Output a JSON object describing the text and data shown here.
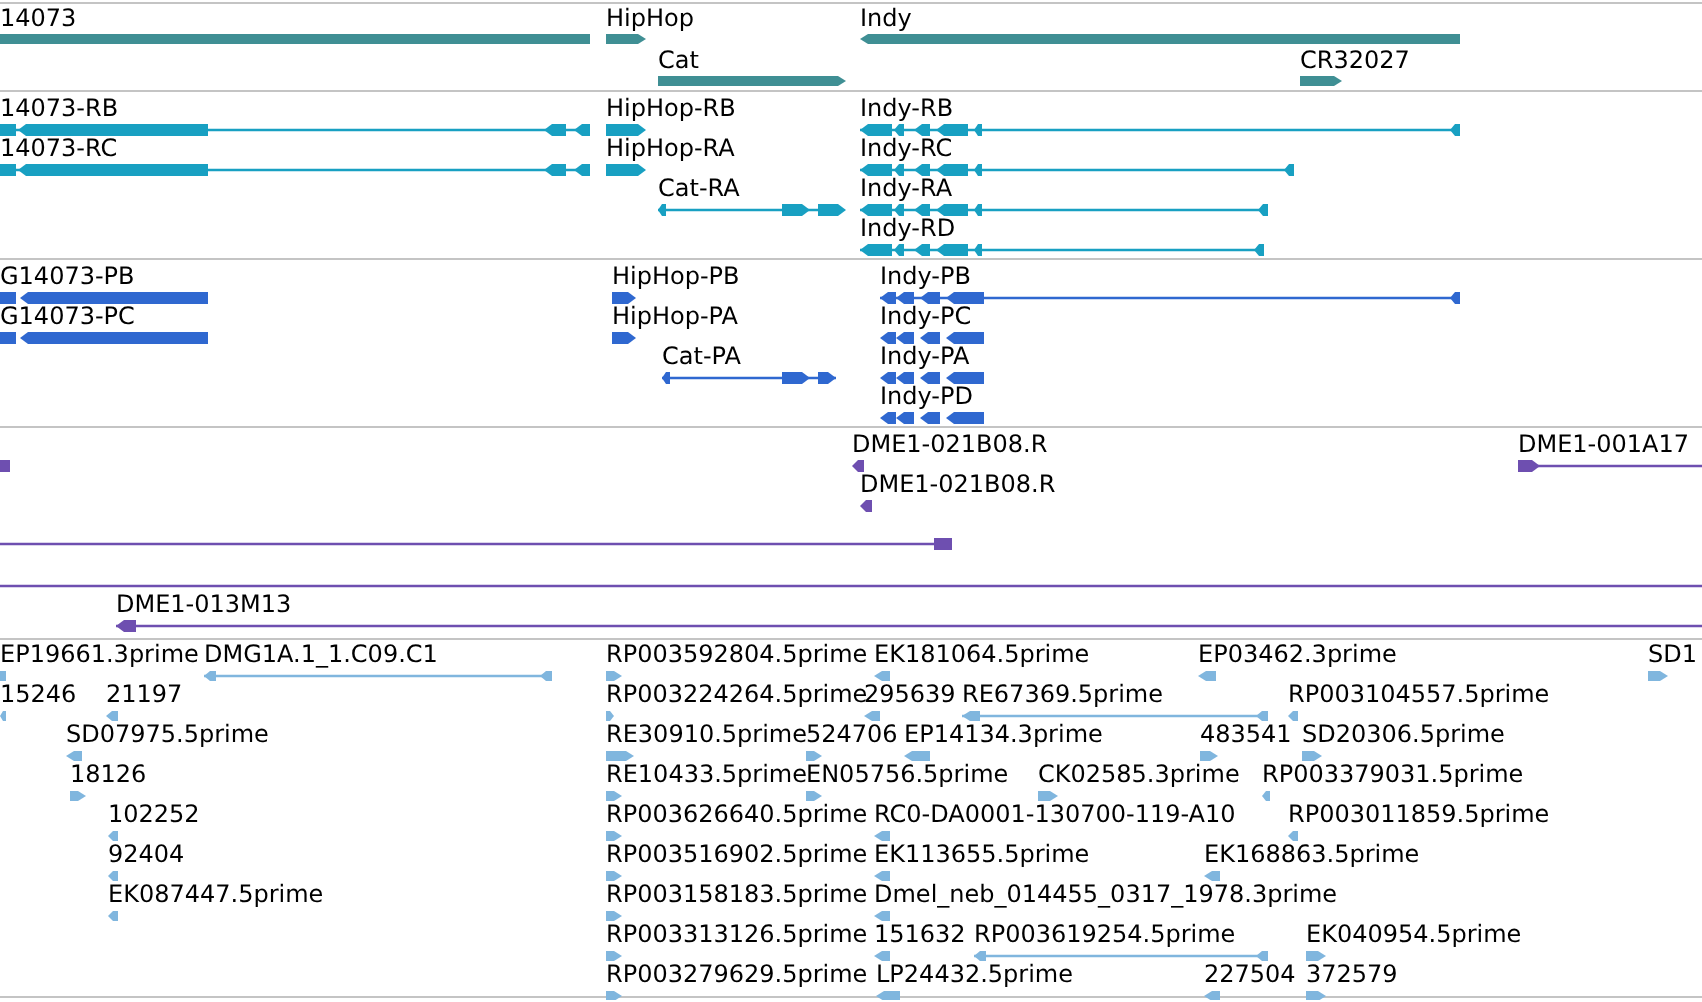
{
  "tracks": [
    {
      "features": [
        {
          "label": "14073"
        },
        {
          "label": "HipHop"
        },
        {
          "label": "Cat"
        },
        {
          "label": "Indy"
        },
        {
          "label": "CR32027"
        }
      ]
    },
    {
      "features": [
        {
          "label": "14073-RB"
        },
        {
          "label": "14073-RC"
        },
        {
          "label": "HipHop-RB"
        },
        {
          "label": "HipHop-RA"
        },
        {
          "label": "Cat-RA"
        },
        {
          "label": "Indy-RB"
        },
        {
          "label": "Indy-RC"
        },
        {
          "label": "Indy-RA"
        },
        {
          "label": "Indy-RD"
        }
      ]
    },
    {
      "features": [
        {
          "label": "G14073-PB"
        },
        {
          "label": "G14073-PC"
        },
        {
          "label": "HipHop-PB"
        },
        {
          "label": "HipHop-PA"
        },
        {
          "label": "Cat-PA"
        },
        {
          "label": "Indy-PB"
        },
        {
          "label": "Indy-PC"
        },
        {
          "label": "Indy-PA"
        },
        {
          "label": "Indy-PD"
        }
      ]
    },
    {
      "features": [
        {
          "label": "DME1-021B08.R"
        },
        {
          "label": "DME1-021B08.R"
        },
        {
          "label": "DME1-001A17"
        },
        {
          "label": "DME1-013M13"
        }
      ]
    },
    {
      "features": [
        {
          "label": "EP19661.3prime"
        },
        {
          "label": "DMG1A.1_1.C09.C1"
        },
        {
          "label": "RP003592804.5prime"
        },
        {
          "label": "EK181064.5prime"
        },
        {
          "label": "EP03462.3prime"
        },
        {
          "label": "SD1"
        },
        {
          "label": "15246"
        },
        {
          "label": "21197"
        },
        {
          "label": "RP003224264.5prime"
        },
        {
          "label": "295639"
        },
        {
          "label": "RE67369.5prime"
        },
        {
          "label": "RP003104557.5prime"
        },
        {
          "label": "SD07975.5prime"
        },
        {
          "label": "RE30910.5prime"
        },
        {
          "label": "524706"
        },
        {
          "label": "EP14134.3prime"
        },
        {
          "label": "483541"
        },
        {
          "label": "SD20306.5prime"
        },
        {
          "label": "18126"
        },
        {
          "label": "RE10433.5prime"
        },
        {
          "label": "EN05756.5prime"
        },
        {
          "label": "CK02585.3prime"
        },
        {
          "label": "RP003379031.5prime"
        },
        {
          "label": "102252"
        },
        {
          "label": "RP003626640.5prime"
        },
        {
          "label": "RC0-DA0001-130700-119-A10"
        },
        {
          "label": "RP003011859.5prime"
        },
        {
          "label": "92404"
        },
        {
          "label": "RP003516902.5prime"
        },
        {
          "label": "EK113655.5prime"
        },
        {
          "label": "EK168863.5prime"
        },
        {
          "label": "EK087447.5prime"
        },
        {
          "label": "RP003158183.5prime"
        },
        {
          "label": "Dmel_neb_014455_0317_1978.3prime"
        },
        {
          "label": "RP003313126.5prime"
        },
        {
          "label": "151632"
        },
        {
          "label": "RP003619254.5prime"
        },
        {
          "label": "EK040954.5prime"
        },
        {
          "label": "RP003279629.5prime"
        },
        {
          "label": "LP24432.5prime"
        },
        {
          "label": "227504"
        },
        {
          "label": "372579"
        }
      ]
    }
  ]
}
